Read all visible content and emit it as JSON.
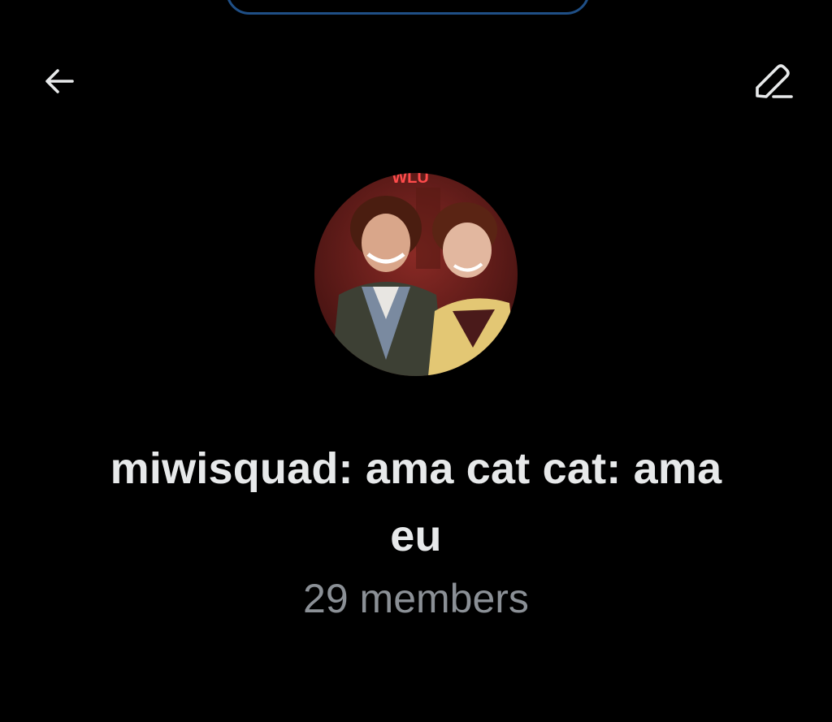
{
  "header": {
    "back_icon": "arrow-left-icon",
    "edit_icon": "pencil-edit-icon"
  },
  "group": {
    "name": "miwisquad: ama cat cat: ama eu",
    "members": "29 members",
    "avatar_description": "group-avatar-photo"
  },
  "colors": {
    "background": "#000000",
    "title": "#e7e9ea",
    "subtitle": "#8b9096",
    "pill_border": "#1f4f86"
  }
}
